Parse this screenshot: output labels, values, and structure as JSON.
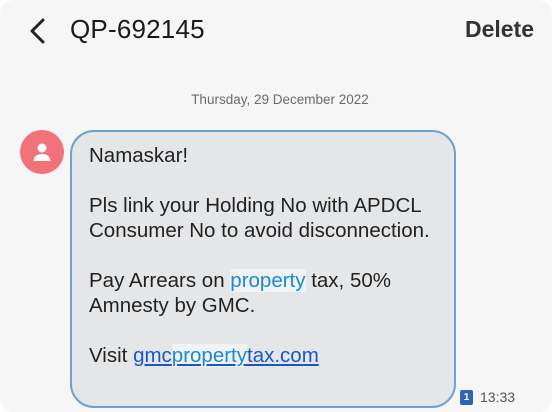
{
  "header": {
    "sender": "QP-692145",
    "delete_label": "Delete",
    "back_icon": "chevron-left-icon"
  },
  "conversation": {
    "date": "Thursday, 29 December 2022",
    "avatar_icon": "person-icon",
    "avatar_color": "#f2727a",
    "message": {
      "greeting": "Namaskar!",
      "line1": "Pls link your Holding No with APDCL Consumer No to avoid disconnection.",
      "pay_prefix": "Pay Arrears on ",
      "pay_highlight": "property",
      "pay_suffix": " tax, 50% Amnesty by GMC.",
      "visit_prefix": "Visit ",
      "link_part1": "gmc",
      "link_highlight": "property",
      "link_part2": "tax.com"
    },
    "sim": "1",
    "time": "13:33"
  },
  "colors": {
    "bubble_bg": "#e5e6e8",
    "bubble_border": "#6f9fd6",
    "highlight": "#1a8ad2",
    "link": "#1a56c8",
    "sim_badge": "#2f63b4"
  }
}
